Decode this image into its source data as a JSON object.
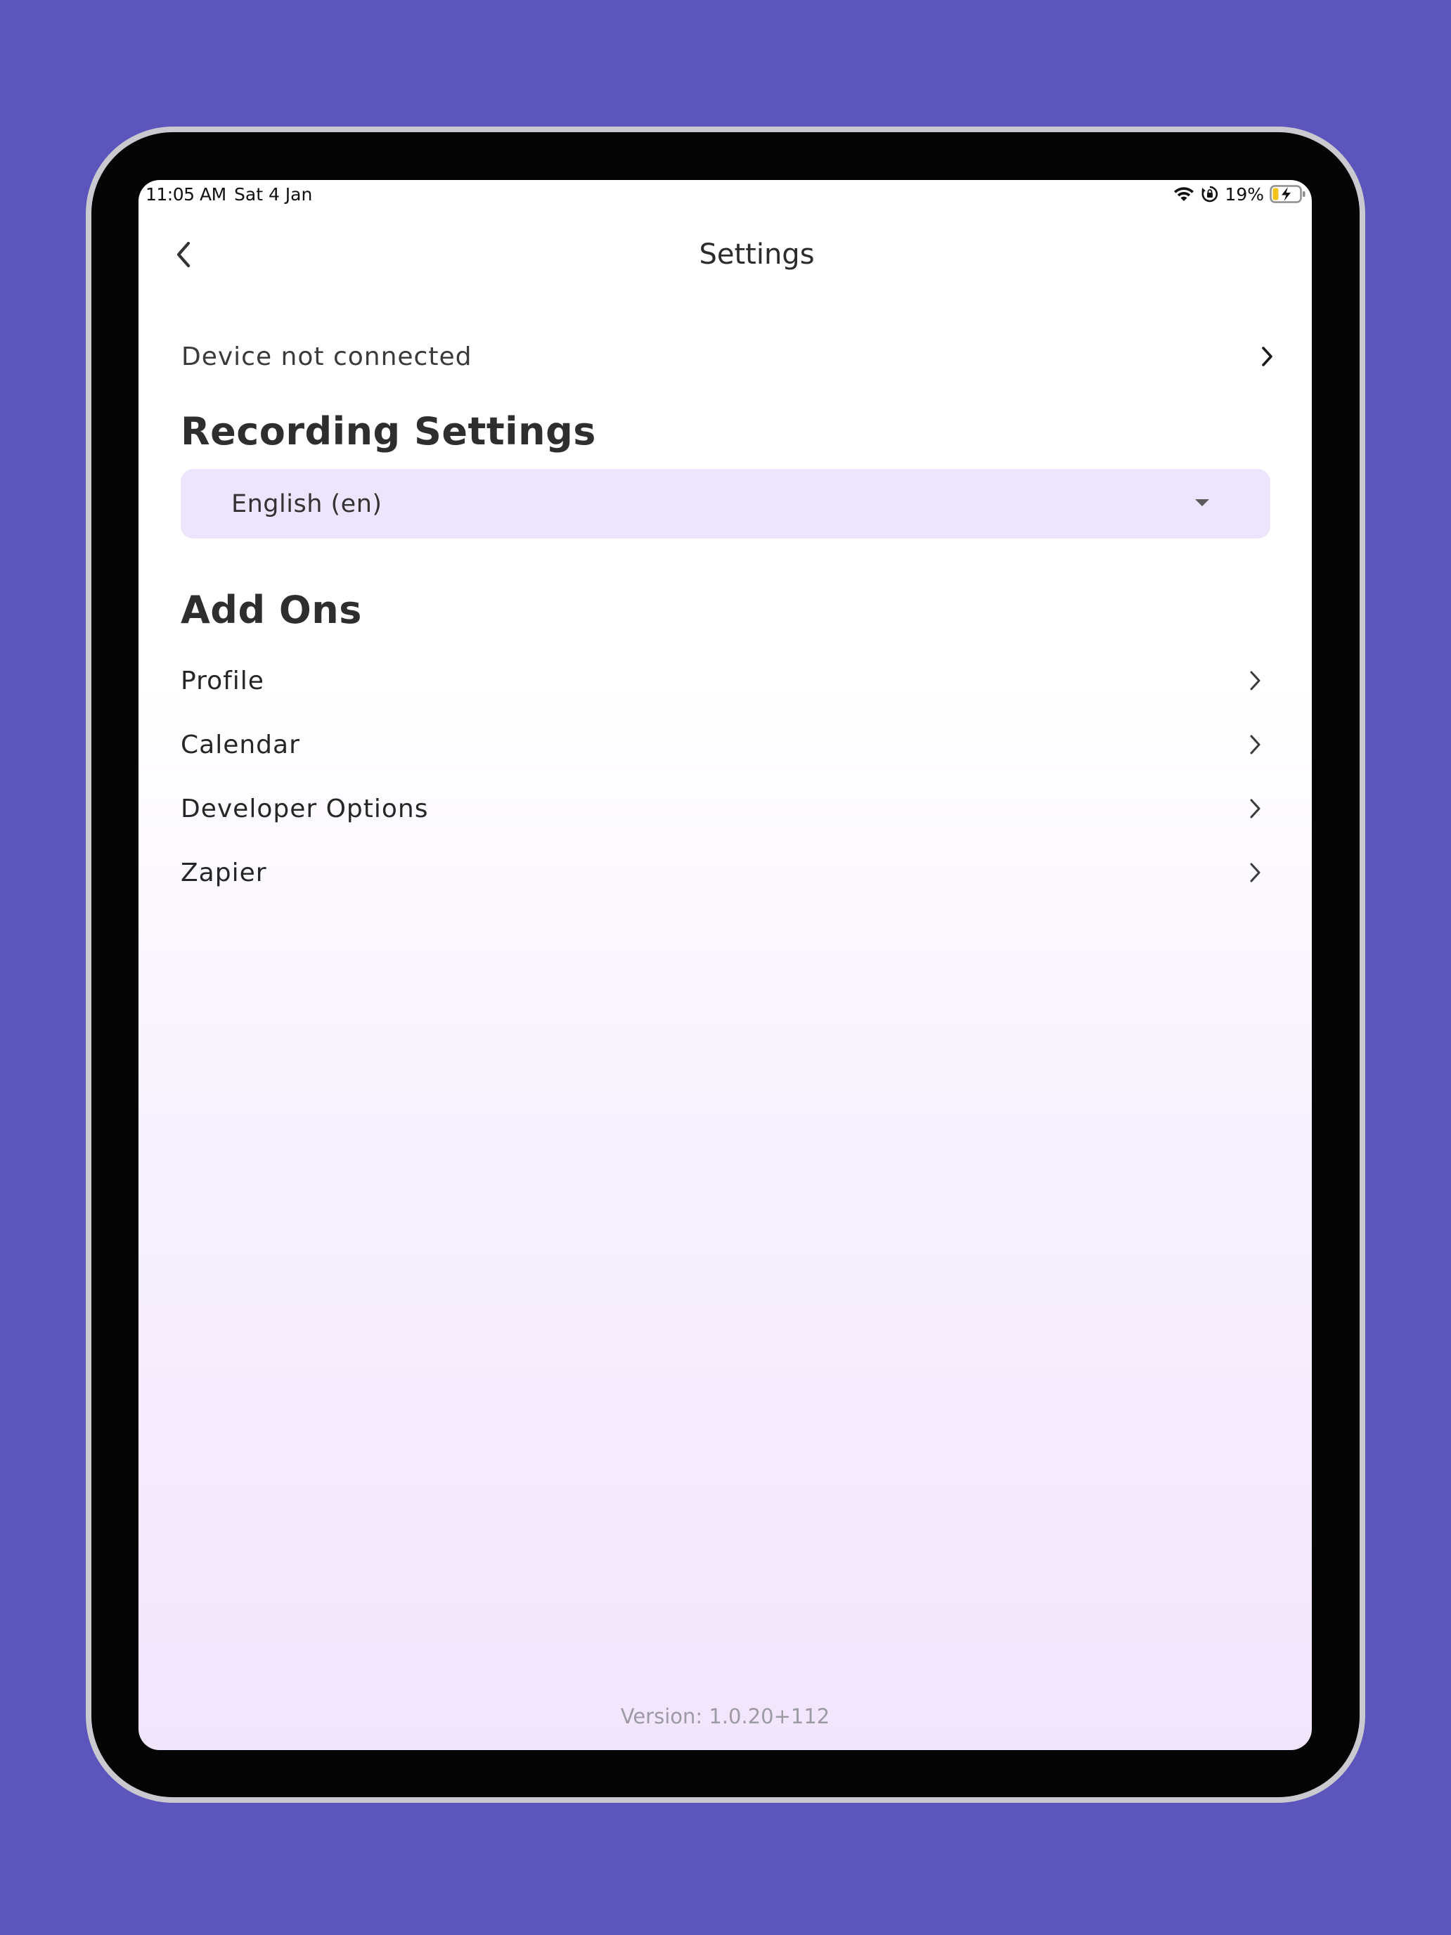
{
  "status_bar": {
    "time": "11:05 AM",
    "date": "Sat 4 Jan",
    "battery_percent": "19%",
    "icons": [
      "wifi-icon",
      "orientation-lock-icon",
      "battery-charging-icon"
    ]
  },
  "header": {
    "title": "Settings",
    "back_icon": "chevron-left-icon"
  },
  "device": {
    "status_label": "Device not connected"
  },
  "recording_settings": {
    "heading": "Recording Settings",
    "language_selected": "English (en)"
  },
  "add_ons": {
    "heading": "Add Ons",
    "items": [
      {
        "label": "Profile"
      },
      {
        "label": "Calendar"
      },
      {
        "label": "Developer Options"
      },
      {
        "label": "Zapier"
      }
    ]
  },
  "footer": {
    "version": "Version: 1.0.20+112"
  },
  "colors": {
    "background": "#5c55bb",
    "dropdown_fill": "#ede4fd",
    "text_primary": "#2e2e2e",
    "text_muted": "#9c9aa2"
  }
}
